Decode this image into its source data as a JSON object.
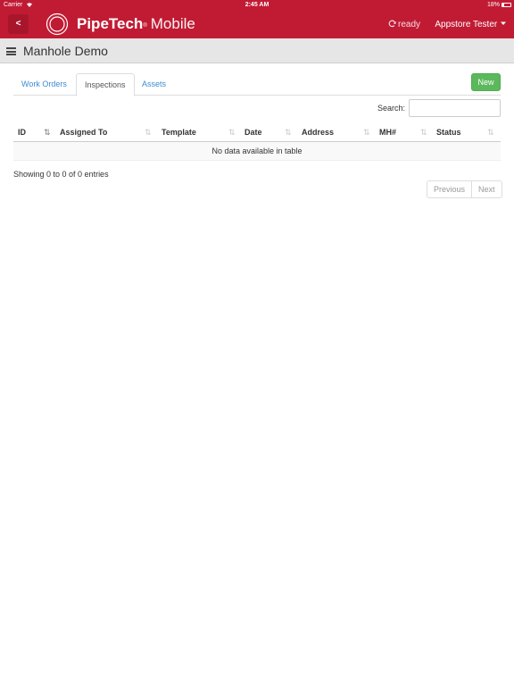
{
  "statusbar": {
    "carrier": "Carrier",
    "time": "2:45 AM",
    "battery": "18%"
  },
  "header": {
    "back_label": "<",
    "brand_name": "PipeTech",
    "brand_tm": "®",
    "brand_suffix": "Mobile",
    "sync_status": "ready",
    "user_menu": "Appstore Tester"
  },
  "colors": {
    "brand": "#c11b34",
    "accent": "#3a8dd0",
    "success": "#5cb85c"
  },
  "title": {
    "text": "Manhole Demo"
  },
  "tabs": [
    {
      "label": "Work Orders"
    },
    {
      "label": "Inspections",
      "active": true
    },
    {
      "label": "Assets"
    }
  ],
  "new_button": "New",
  "search": {
    "label": "Search:",
    "value": ""
  },
  "table": {
    "columns": [
      "ID",
      "Assigned To",
      "Template",
      "Date",
      "Address",
      "MH#",
      "Status"
    ],
    "empty_message": "No data available in table"
  },
  "info": "Showing 0 to 0 of 0 entries",
  "pagination": {
    "previous": "Previous",
    "next": "Next"
  }
}
